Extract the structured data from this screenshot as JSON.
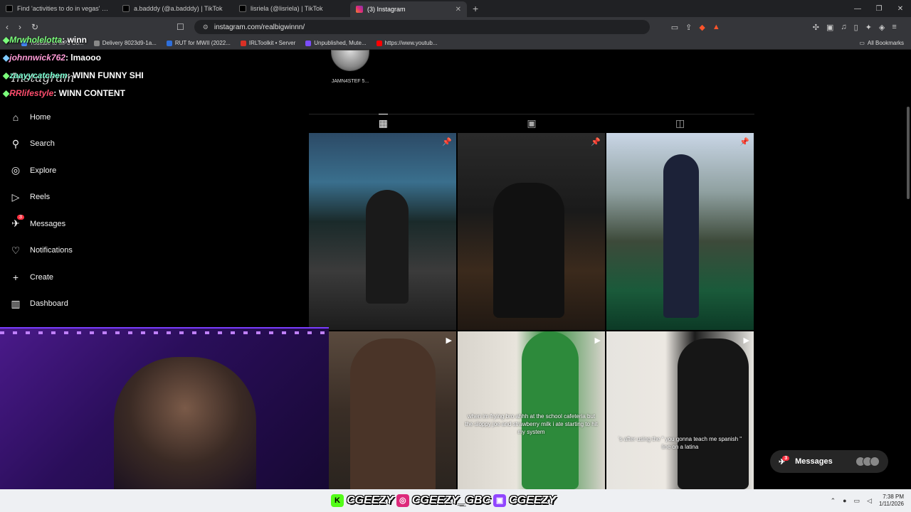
{
  "browser": {
    "tabs": [
      {
        "title": "Find 'activities to do in vegas' on TikT",
        "active": false
      },
      {
        "title": "a.badddy (@a.badddy) | TikTok",
        "active": false
      },
      {
        "title": "lisriela (@lisriela) | TikTok",
        "active": false
      },
      {
        "title": "(3) Instagram",
        "active": true
      }
    ],
    "url": "instagram.com/realbigwinnn/",
    "bookmarks": [
      {
        "label": "Youtube to MP3 Co...",
        "color": "#4285f4"
      },
      {
        "label": "Delivery 8023d9-1a...",
        "color": "#888888"
      },
      {
        "label": "RUT for MWII (2022...",
        "color": "#2e6fdb"
      },
      {
        "label": "IRLToolkit • Server",
        "color": "#d93025"
      },
      {
        "label": "Unpublished, Mute...",
        "color": "#7b4dff"
      },
      {
        "label": "https://www.youtub...",
        "color": "#ff0000"
      }
    ],
    "all_bookmarks": "All Bookmarks"
  },
  "chat": [
    {
      "user": "Mrwholelotta",
      "user_color": "#7bff7b",
      "message": "winn"
    },
    {
      "user": "johnnwick762",
      "user_color": "#ff9ad6",
      "message": "lmaooo"
    },
    {
      "user": "zaayycatchem",
      "user_color": "#7fffd4",
      "message": "WINN FUNNY SHI"
    },
    {
      "user": "RRlifestyle",
      "user_color": "#ff4d6d",
      "message": "WINN CONTENT"
    }
  ],
  "instagram": {
    "logo": "Instagram",
    "nav": [
      {
        "label": "Home",
        "icon": "⌂"
      },
      {
        "label": "Search",
        "icon": "⚲"
      },
      {
        "label": "Explore",
        "icon": "◎"
      },
      {
        "label": "Reels",
        "icon": "▷"
      },
      {
        "label": "Messages",
        "icon": "✈",
        "badge": "3"
      },
      {
        "label": "Notifications",
        "icon": "♡"
      },
      {
        "label": "Create",
        "icon": "+"
      },
      {
        "label": "Dashboard",
        "icon": "▥"
      }
    ],
    "highlight_name": "JAMN4STEF 5...",
    "grid_tabs": [
      "▦",
      "▣",
      "◫"
    ],
    "posts": [
      {
        "marker": "📌",
        "caption": ""
      },
      {
        "marker": "📌",
        "caption": ""
      },
      {
        "marker": "📌",
        "caption": ""
      },
      {
        "marker": "▶",
        "caption": ""
      },
      {
        "marker": "▶",
        "caption": "when im frying bro ahhh at the school cafeteria but the sloppy joe and strawberry milk i ate starting to hit my system"
      },
      {
        "marker": "▶",
        "caption": "’s after using the \" you gonna teach me spanish \" line on a latina"
      }
    ],
    "messages_pill": {
      "label": "Messages",
      "badge": "3"
    }
  },
  "overlay": {
    "socials": [
      {
        "icon": "K",
        "color": "#53fc18",
        "handle": "CGEEZY"
      },
      {
        "icon": "◎",
        "color": "#dd2a7b",
        "handle": "CGEEZY_GBC"
      },
      {
        "icon": "▣",
        "color": "#9146ff",
        "handle": "CGEEZY"
      }
    ]
  },
  "taskbar": {
    "time": "7:38 PM",
    "date": "1/11/2026"
  }
}
